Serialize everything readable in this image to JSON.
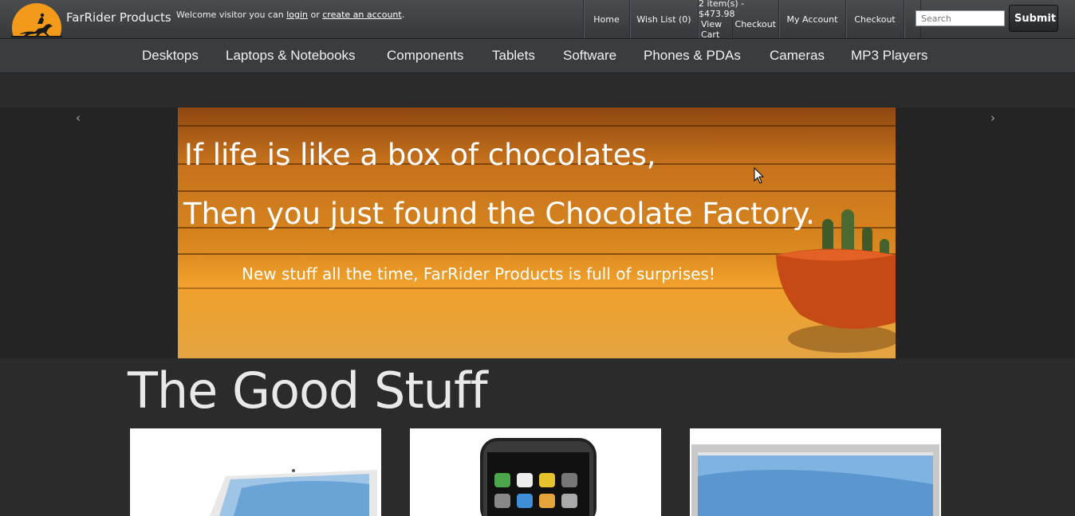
{
  "header": {
    "brand": "FarRider Products",
    "welcome_prefix": "Welcome visitor you can ",
    "login_link": "login",
    "or_text": " or ",
    "create_account_link": "create an account",
    "period": "."
  },
  "top_nav": {
    "home": "Home",
    "wish_list": "Wish List (0)",
    "cart_summary": "2 item(s) - $473.98",
    "view_cart": "View Cart",
    "cart_checkout": "Checkout",
    "my_account": "My Account",
    "checkout": "Checkout"
  },
  "search": {
    "placeholder": "Search",
    "button": "Submit"
  },
  "categories": [
    "Desktops",
    "Laptops & Notebooks",
    "Components",
    "Tablets",
    "Software",
    "Phones & PDAs",
    "Cameras",
    "MP3 Players"
  ],
  "slider": {
    "prev_arrow": "‹",
    "next_arrow": "›",
    "line1": "If life is like a box of chocolates,",
    "line2": "Then you just found the Chocolate Factory.",
    "line3": "New stuff all the time, FarRider Products is full of surprises!"
  },
  "section_heading": "The Good Stuff",
  "colors": {
    "logo_orange": "#f39a1a",
    "banner_wood": "#d8861f",
    "background": "#2b2b2b"
  }
}
